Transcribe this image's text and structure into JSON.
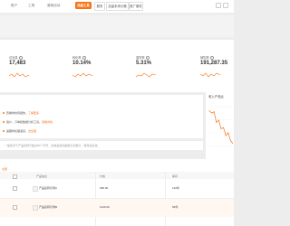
{
  "nav": {
    "items": [
      "账户",
      "工具",
      "营销活动",
      "选品工具"
    ],
    "buttons": [
      "服务",
      "加量未来价格",
      "推广服务"
    ],
    "colors": {
      "accent": "#f97316",
      "active": "#e55353"
    }
  },
  "kpis": [
    {
      "title": "访问量",
      "value": "17,483"
    },
    {
      "title": "转化率",
      "value": "10.14%"
    },
    {
      "title": "退货率",
      "value": "5.31%"
    },
    {
      "title": "销售额",
      "value": "191,287.35"
    }
  ],
  "side_panel": {
    "title": "收入产品比"
  },
  "side_chart": {
    "type": "line",
    "series": [
      {
        "values": [
          92,
          88,
          90,
          70,
          74,
          58,
          60,
          45,
          50,
          35,
          30
        ]
      }
    ]
  },
  "tips": [
    {
      "text": "查看你的周报告，",
      "link": "了解更多"
    },
    {
      "text": "用户、订单和数据分析工具，",
      "link": "查看详情"
    },
    {
      "text": "提醒你处理退货，",
      "link": "去处理"
    }
  ],
  "notice": "一般情况下产品名称不超过80个字符，系统会自动截断过长部分，保存后生效。",
  "table": {
    "tab_label": "全部",
    "columns": [
      "产品信息",
      "价格",
      "库存"
    ],
    "rows": [
      {
        "name": "产品名称示例A",
        "price": "¥88.00",
        "stock": "120件"
      },
      {
        "name": "产品名称示例B",
        "price": "¥126.00",
        "stock": "56件"
      }
    ]
  }
}
